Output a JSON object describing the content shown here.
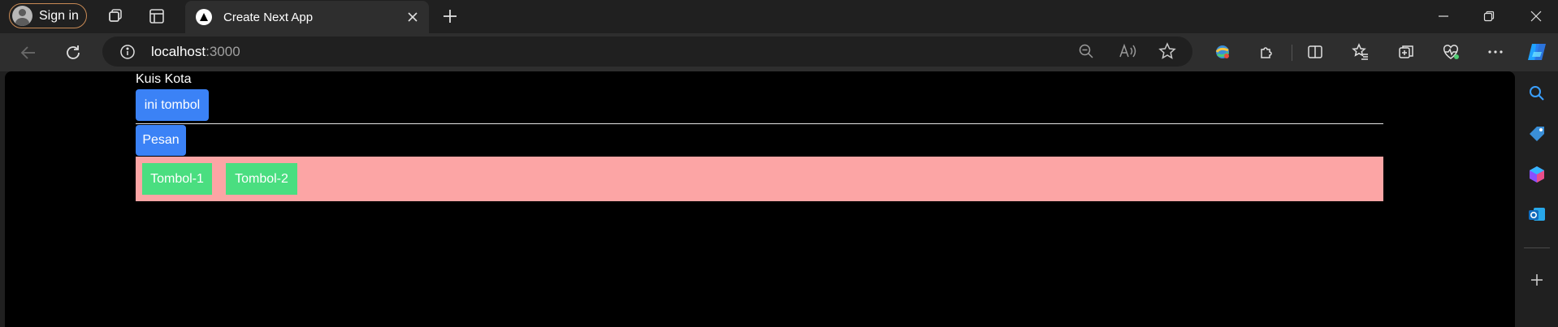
{
  "browser": {
    "signin_label": "Sign in",
    "tab_title": "Create Next App",
    "new_tab_symbol": "+",
    "url_host": "localhost",
    "url_port": ":3000",
    "colors": {
      "frame": "#202020",
      "toolbar": "#2e2e2e",
      "signin_border": "#c88a55"
    }
  },
  "page": {
    "title": "Kuis Kota",
    "button_primary": "ini tombol",
    "button_message": "Pesan",
    "group_buttons": [
      "Tombol-1",
      "Tombol-2"
    ],
    "colors": {
      "background": "#000000",
      "blue_button": "#3b82f6",
      "pink_panel": "#fca5a5",
      "green_button": "#4ade80"
    }
  },
  "icons": {
    "titlebar": [
      "avatar",
      "workspaces-icon",
      "tab-actions-icon",
      "nextjs-favicon",
      "close-icon",
      "new-tab-icon",
      "minimize-icon",
      "restore-icon",
      "window-close-icon"
    ],
    "toolbar": [
      "back-icon",
      "refresh-icon",
      "info-icon",
      "zoom-out-icon",
      "read-aloud-icon",
      "favorite-star-icon",
      "profile-sync-icon",
      "extensions-icon",
      "split-screen-icon",
      "favorites-icon",
      "collections-icon",
      "browser-essentials-icon",
      "more-icon",
      "copilot-icon"
    ],
    "sidebar": [
      "search-icon",
      "shopping-icon",
      "m365-icon",
      "outlook-icon",
      "add-icon"
    ]
  }
}
